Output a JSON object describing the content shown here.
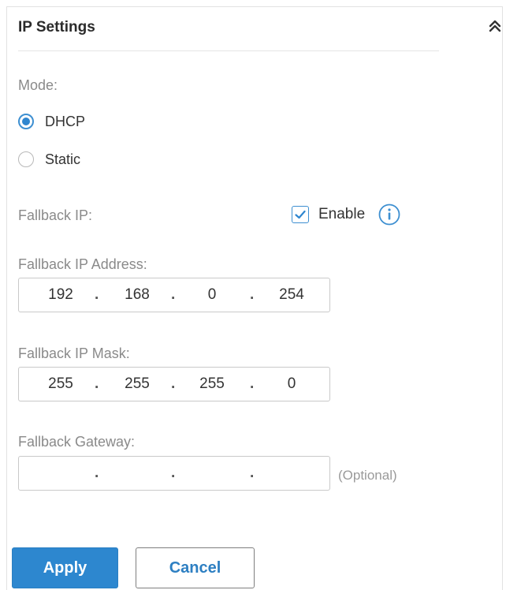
{
  "section": {
    "title": "IP Settings"
  },
  "mode": {
    "label": "Mode:",
    "options": [
      {
        "label": "DHCP",
        "checked": true
      },
      {
        "label": "Static",
        "checked": false
      }
    ]
  },
  "fallback_ip": {
    "label": "Fallback IP:",
    "enable_label": "Enable",
    "enabled": true
  },
  "fallback_address": {
    "label": "Fallback IP Address:",
    "octets": [
      "192",
      "168",
      "0",
      "254"
    ]
  },
  "fallback_mask": {
    "label": "Fallback IP Mask:",
    "octets": [
      "255",
      "255",
      "255",
      "0"
    ]
  },
  "fallback_gateway": {
    "label": "Fallback Gateway:",
    "octets": [
      "",
      "",
      "",
      ""
    ],
    "hint": "(Optional)"
  },
  "actions": {
    "apply_label": "Apply",
    "cancel_label": "Cancel"
  },
  "colors": {
    "accent": "#2d87cf",
    "label_gray": "#8a8a8a"
  },
  "icons": {
    "collapse": "double-chevron-up-icon",
    "info": "info-circle-icon",
    "check": "checkmark-icon"
  }
}
